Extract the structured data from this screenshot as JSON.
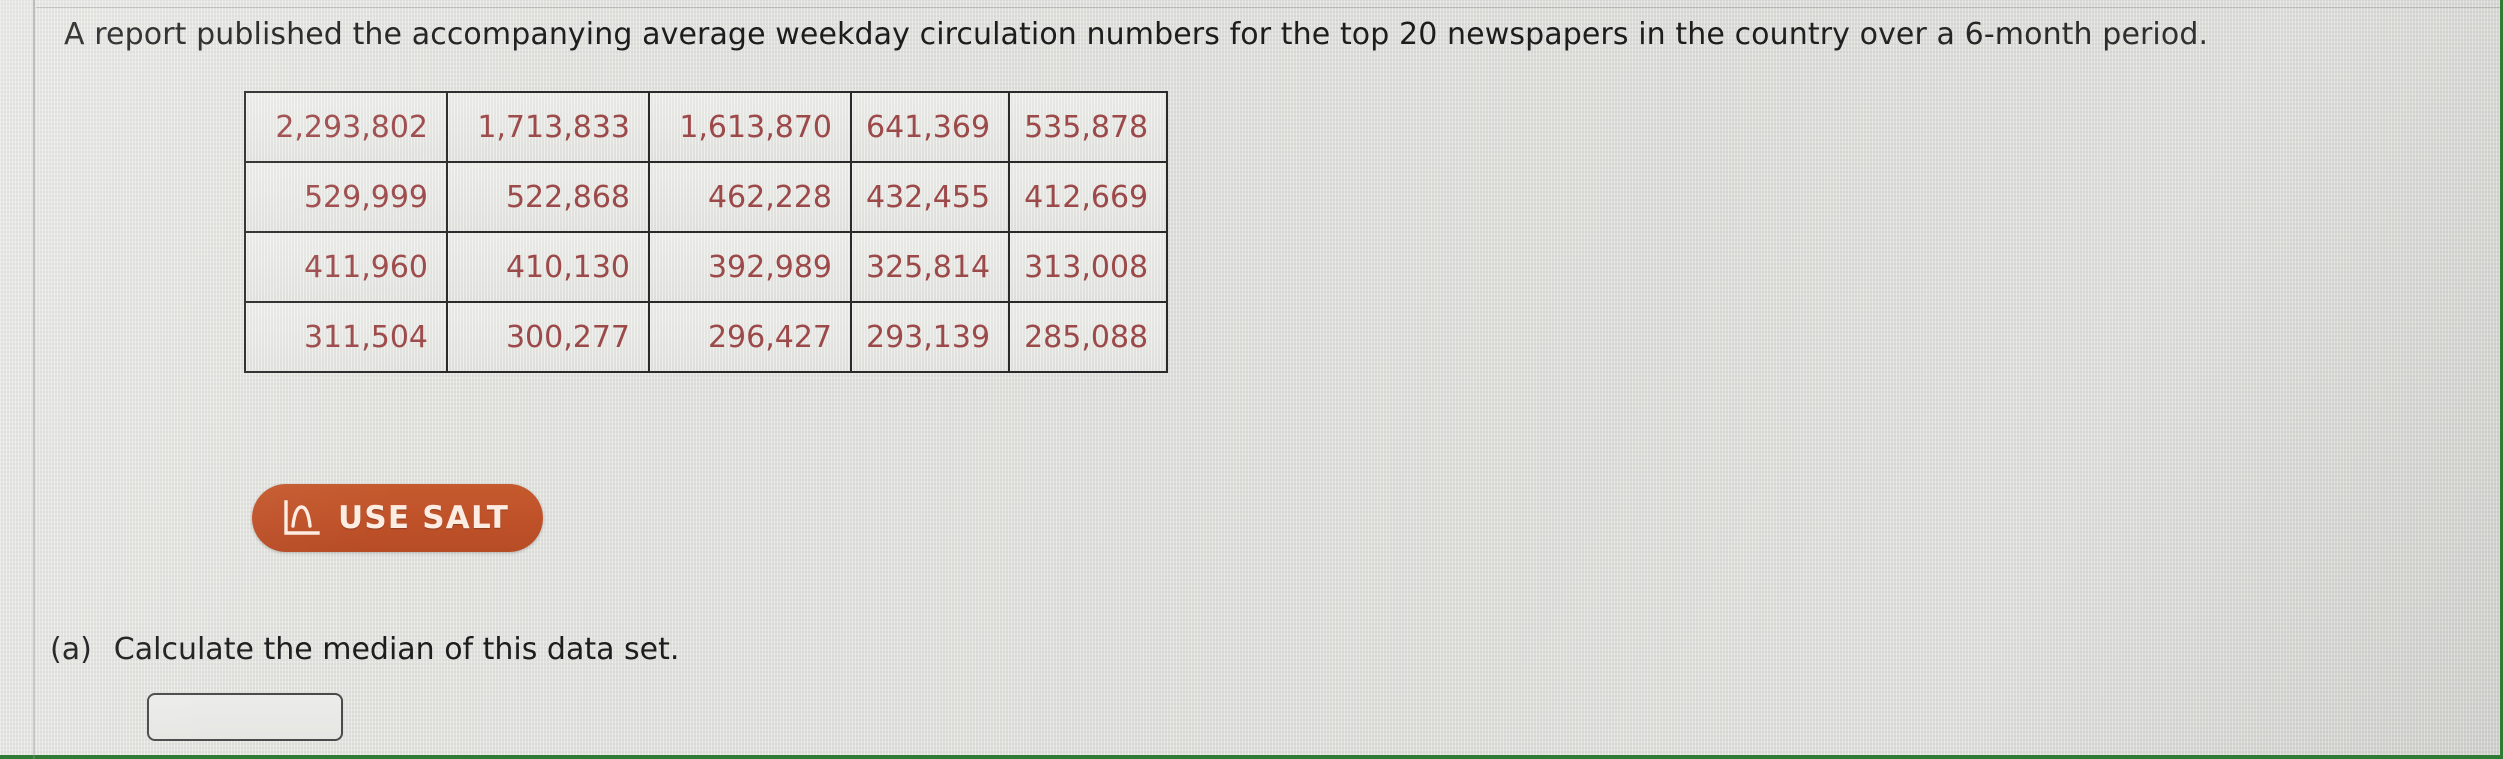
{
  "prompt": {
    "text": "A report published the accompanying average weekday circulation numbers for the top 20 newspapers in the country over a 6-month period."
  },
  "data_table": {
    "rows": [
      [
        "2,293,802",
        "1,713,833",
        "1,613,870",
        "641,369",
        "535,878"
      ],
      [
        "529,999",
        "522,868",
        "462,228",
        "432,455",
        "412,669"
      ],
      [
        "411,960",
        "410,130",
        "392,989",
        "325,814",
        "313,008"
      ],
      [
        "311,504",
        "300,277",
        "296,427",
        "293,139",
        "285,088"
      ]
    ],
    "text_color": "#9c4949",
    "border_color": "#2a2a2a"
  },
  "use_salt": {
    "label": "USE SALT",
    "icon": "distribution-curve-icon",
    "background_color": "#bf5129",
    "label_color": "#fdece2"
  },
  "part_a": {
    "marker": "(a)",
    "question": "Calculate the median of this data set.",
    "answer_value": "",
    "answer_placeholder": ""
  },
  "page": {
    "accent_border_color": "#2f7a34",
    "background_color": "#dedeDA"
  }
}
